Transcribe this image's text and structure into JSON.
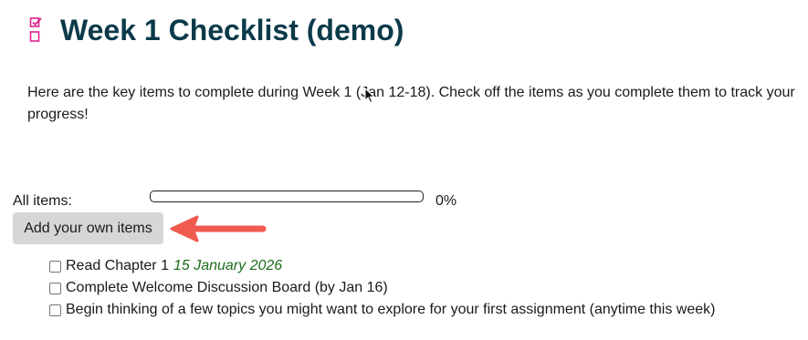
{
  "page": {
    "title": "Week 1 Checklist (demo)",
    "intro": "Here are the key items to complete during Week 1 (Jan 12-18). Check off the items as you complete them to track your progress!"
  },
  "progress": {
    "label": "All items:",
    "percent_text": "0%",
    "fraction_complete": 0
  },
  "actions": {
    "add_items_label": "Add your own items"
  },
  "checklist": {
    "items": [
      {
        "label": "Read Chapter 1",
        "due": "15 January 2026",
        "checked": false
      },
      {
        "label": "Complete Welcome Discussion Board (by Jan 16)",
        "checked": false
      },
      {
        "label": "Begin thinking of a few topics you might want to explore for your first assignment (anytime this week)",
        "checked": false
      }
    ]
  },
  "colors": {
    "title": "#0b3a4a",
    "icon_accent": "#e0208a",
    "due_date": "#1b6b1b",
    "annotation_arrow": "#ef5b4f",
    "button_bg": "#d6d6d6"
  },
  "icons": {
    "header": "checklist-icon",
    "annotation": "arrow-left-icon",
    "pointer": "mouse-cursor-icon"
  }
}
